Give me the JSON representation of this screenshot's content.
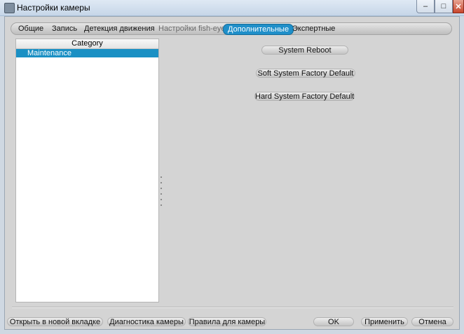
{
  "window": {
    "title": "Настройки камеры",
    "minimize_icon": "minimize-icon",
    "maximize_icon": "maximize-icon",
    "close_icon": "close-icon",
    "minimize_glyph": "–",
    "maximize_glyph": "□",
    "close_glyph": "✕"
  },
  "tabs": [
    {
      "label": "Общие"
    },
    {
      "label": "Запись"
    },
    {
      "label": "Детекция движения"
    },
    {
      "label": "Настройки fish-eye"
    },
    {
      "label": "Дополнительные"
    },
    {
      "label": "Экспертные"
    }
  ],
  "category_panel": {
    "header": "Category",
    "items": [
      {
        "label": "Maintenance"
      }
    ]
  },
  "actions": {
    "reboot": "System Reboot",
    "soft_default": "Soft System Factory Default",
    "hard_default": "Hard System Factory Default"
  },
  "footer": {
    "open_tab": "Открыть в новой вкладке",
    "diagnostics": "Диагностика камеры",
    "rules": "Правила для камеры",
    "ok": "OK",
    "apply": "Применить",
    "cancel": "Отмена"
  },
  "colors": {
    "accent": "#1f8fc9",
    "selection": "#1a90c4"
  }
}
